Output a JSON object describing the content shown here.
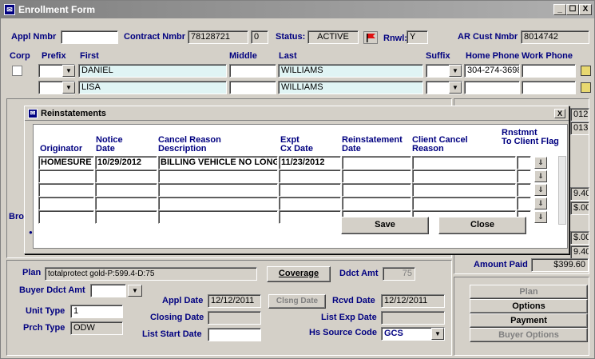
{
  "window": {
    "title": "Enrollment Form",
    "min": "_",
    "max": "☐",
    "close": "X"
  },
  "header": {
    "appl_nmbr_label": "Appl Nmbr",
    "appl_nmbr": "",
    "contract_label": "Contract Nmbr",
    "contract": "78128721",
    "contract_suffix": "0",
    "status_label": "Status:",
    "status": "ACTIVE",
    "rnwl_label": "Rnwl:",
    "rnwl": "Y",
    "ar_label": "AR Cust Nmbr",
    "ar": "8014742"
  },
  "names": {
    "corp_label": "Corp",
    "prefix_label": "Prefix",
    "first_label": "First",
    "middle_label": "Middle",
    "last_label": "Last",
    "suffix_label": "Suffix",
    "home_label": "Home Phone",
    "work_label": "Work Phone",
    "rows": [
      {
        "first": "DANIEL",
        "last": "WILLIAMS",
        "home": "304-274-3698"
      },
      {
        "first": "LISA",
        "last": "WILLIAMS",
        "home": ""
      }
    ]
  },
  "bg_partial": {
    "rv1": "012",
    "rv2": "013",
    "bro": "Bro",
    "v1": "9.40",
    "v2": "$.00",
    "v3": "$.00",
    "v4": "9.40"
  },
  "dialog": {
    "title": "Reinstatements",
    "close": "X",
    "headers": {
      "originator": "Originator",
      "notice1": "Notice",
      "notice2": "Date",
      "cancel1": "Cancel Reason",
      "cancel2": "Description",
      "expt1": "Expt",
      "expt2": "Cx Date",
      "reinst1": "Reinstatement",
      "reinst2": "Date",
      "client1": "Client Cancel",
      "client2": "Reason",
      "flag1": "Rnstmnt",
      "flag2": "To Client Flag"
    },
    "rows": [
      {
        "originator": "HOMESURE",
        "notice": "10/29/2012",
        "cancel": "BILLING VEHICLE NO LONG",
        "expt": "11/23/2012",
        "reinst": "",
        "client": ""
      },
      {
        "originator": "",
        "notice": "",
        "cancel": "",
        "expt": "",
        "reinst": "",
        "client": ""
      },
      {
        "originator": "",
        "notice": "",
        "cancel": "",
        "expt": "",
        "reinst": "",
        "client": ""
      },
      {
        "originator": "",
        "notice": "",
        "cancel": "",
        "expt": "",
        "reinst": "",
        "client": ""
      },
      {
        "originator": "",
        "notice": "",
        "cancel": "",
        "expt": "",
        "reinst": "",
        "client": ""
      }
    ],
    "save": "Save",
    "close_btn": "Close"
  },
  "bottom": {
    "plan_label": "Plan",
    "plan": "totalprotect gold-P:599.4-D:75",
    "coverage": "Coverage",
    "ddct_label": "Ddct Amt",
    "ddct": "75",
    "buyer_ddct_label": "Buyer Ddct Amt",
    "buyer_ddct": "",
    "unit_label": "Unit Type",
    "unit": "1",
    "prch_label": "Prch Type",
    "prch": "ODW",
    "appl_date_label": "Appl Date",
    "appl_date": "12/12/2011",
    "clsng_btn": "Clsng Date",
    "rcvd_label": "Rcvd Date",
    "rcvd": "12/12/2011",
    "closing_label": "Closing Date",
    "closing": "",
    "list_exp_label": "List Exp Date",
    "list_exp": "",
    "list_start_label": "List Start Date",
    "list_start": "",
    "hs_label": "Hs Source Code",
    "hs": "GCS",
    "amount_paid_label": "Amount Paid",
    "amount_paid": "$399.60"
  },
  "side_buttons": {
    "plan": "Plan",
    "options": "Options",
    "payment": "Payment",
    "buyer_options": "Buyer Options"
  },
  "colors": {
    "accent": "#000080",
    "flag": "#e01010",
    "field_cyan": "#e0f4f4"
  }
}
